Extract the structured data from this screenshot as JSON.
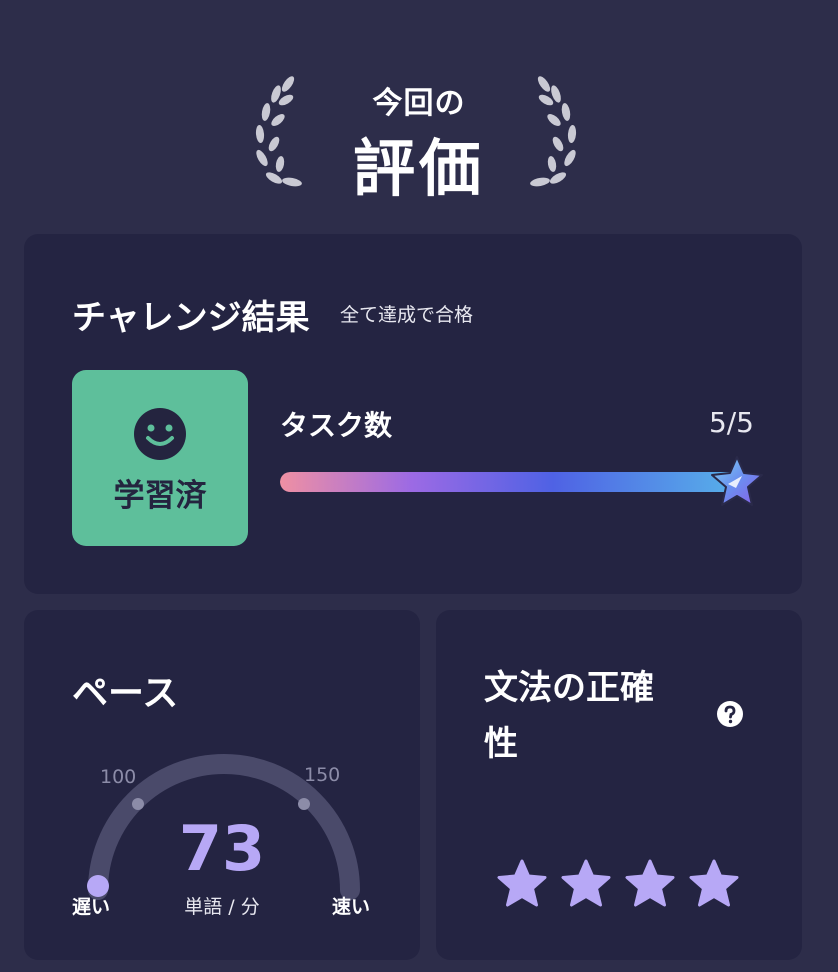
{
  "header": {
    "subtitle": "今回の",
    "title": "評価"
  },
  "challenge": {
    "title": "チャレンジ結果",
    "note": "全て達成で合格",
    "status_label": "学習済",
    "task_label": "タスク数",
    "task_done": 5,
    "task_total": 5,
    "task_count_text": "5/5"
  },
  "pace": {
    "title": "ペース",
    "value": "73",
    "unit": "単語 / 分",
    "tick_low": "100",
    "tick_high": "150",
    "slow_label": "遅い",
    "fast_label": "速い",
    "value_num": 73
  },
  "grammar": {
    "title": "文法の正確性",
    "stars_filled": 4,
    "stars_total": 4
  },
  "colors": {
    "background": "#2d2d4a",
    "card": "#242442",
    "learned_green": "#5ebf9b",
    "accent_purple": "#b7a8f6"
  },
  "icons": [
    "laurel-left-icon",
    "laurel-right-icon",
    "smiley-icon",
    "star-badge-icon",
    "help-icon",
    "star-icon"
  ]
}
